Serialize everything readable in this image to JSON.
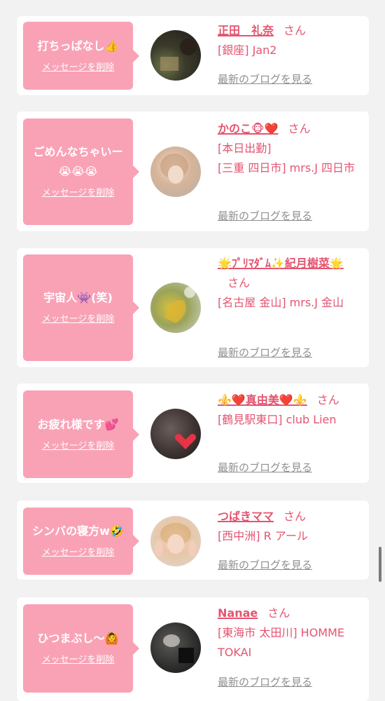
{
  "delete_label": "メッセージを削除",
  "blog_label": "最新のブログを見る",
  "colors": {
    "accent_pink": "#f9a2b6",
    "name_red": "#e45470",
    "link_gray": "#8f8f8f"
  },
  "items": [
    {
      "message": "打ちっぱなし👍",
      "name": "正田　礼奈",
      "san": "さん",
      "details": "[銀座] Jan2"
    },
    {
      "message": "ごめんなちゃいー😭😭😭",
      "name": "かのこ🐵❤️",
      "san": "さん",
      "details": "[本日出勤]\n[三重 四日市] mrs.J 四日市"
    },
    {
      "message": "宇宙人👾(笑)",
      "name": "🌟ﾌﾟﾘﾏﾀﾞﾑ✨紀月樹菜🌟",
      "san": "さん",
      "details": "[名古屋 金山] mrs.J 金山"
    },
    {
      "message": "お疲れ様です💕",
      "name": "⚜️❤️真由美❤️⚜️",
      "san": "さん",
      "details": "[鶴見駅東口] club Lien"
    },
    {
      "message": "シンバの寝方w🤣",
      "name": "つばきママ",
      "san": "さん",
      "details": "[西中洲] R アール"
    },
    {
      "message": "ひつまぶし〜🙆",
      "name": "Nanae",
      "san": "さん",
      "details": "[東海市 太田川] HOMME TOKAI"
    }
  ]
}
